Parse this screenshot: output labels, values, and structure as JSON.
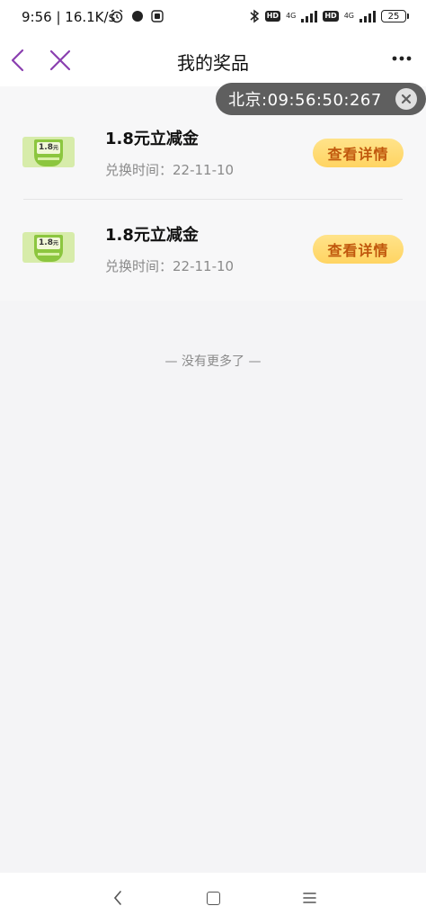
{
  "status_bar": {
    "time": "9:56 | 16.1K/s",
    "hd1": "HD",
    "net1": "4G",
    "hd2": "HD",
    "net2": "4G",
    "battery": "25"
  },
  "header": {
    "title": "我的奖品"
  },
  "clock_pill": {
    "text": "北京:09:56:50:267"
  },
  "prizes": [
    {
      "thumb_value": "1.8",
      "thumb_unit": "元",
      "name": "1.8元立减金",
      "date": "兑换时间：22-11-10",
      "button": "查看详情"
    },
    {
      "thumb_value": "1.8",
      "thumb_unit": "元",
      "name": "1.8元立减金",
      "date": "兑换时间：22-11-10",
      "button": "查看详情"
    }
  ],
  "list_footer": "— 没有更多了 —",
  "colors": {
    "accent_purple": "#8a3fb0",
    "button_text": "#c0570c",
    "button_bg": "#ffd462"
  },
  "icons": {
    "back": "chevron-left-icon",
    "close": "close-icon",
    "more": "more-dots-icon",
    "pill_close": "close-circle-icon"
  }
}
